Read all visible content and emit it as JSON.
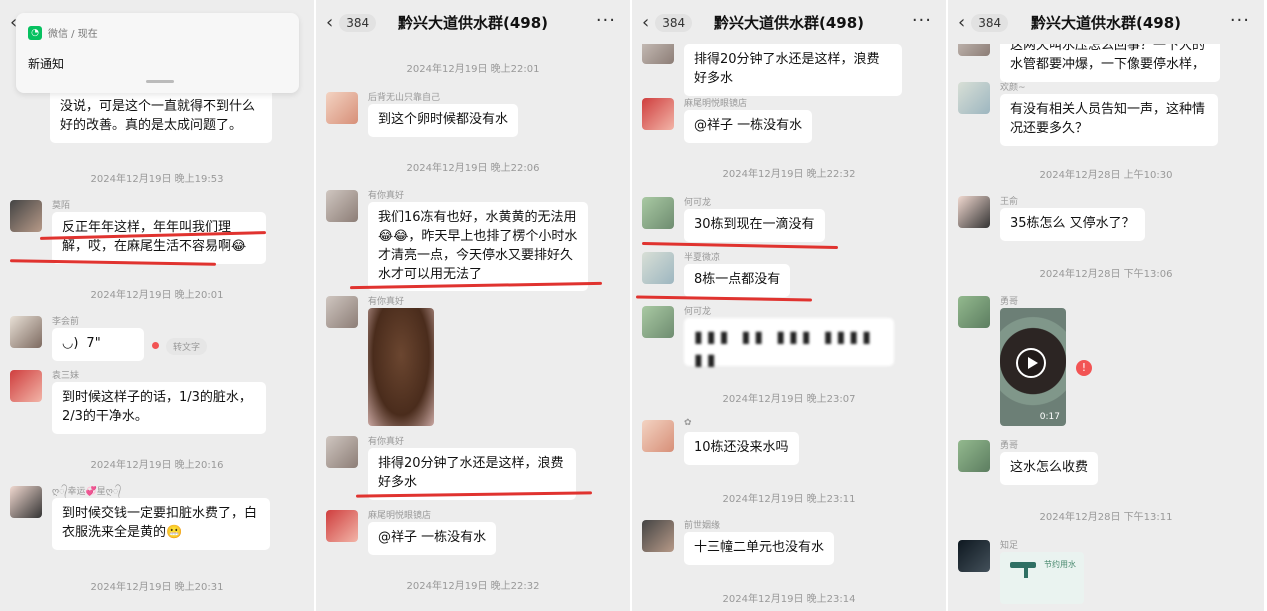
{
  "common": {
    "group_title": "黔兴大道供水群(498)",
    "unread_count": "384",
    "more_icon": "more-dots-icon"
  },
  "panel1": {
    "notification": {
      "app": "微信 / 现在",
      "text": "新通知"
    },
    "items": [
      {
        "type": "bubble_only",
        "text": "点，那我们想到大家都不容易，也没说，可是这个一直就得不到什么好的改善。真的是太成问题了。"
      },
      {
        "type": "time",
        "text": "2024年12月19日 晚上19:53"
      },
      {
        "type": "msg",
        "name": "莫陌",
        "text": "反正年年这样，年年叫我们理解，哎，在麻尾生活不容易啊😂"
      },
      {
        "type": "time",
        "text": "2024年12月19日 晚上20:01"
      },
      {
        "type": "voice",
        "name": "李会前",
        "text": "7\"",
        "convert": "转文字"
      },
      {
        "type": "msg",
        "name": "袁三妹",
        "text": "到时候这样子的话，1/3的脏水，2/3的干净水。"
      },
      {
        "type": "time",
        "text": "2024年12月19日 晚上20:16"
      },
      {
        "type": "msg",
        "name": "ღ᭄幸运💞星ღ᭄",
        "text": "到时候交钱一定要扣脏水费了，白衣服洗来全是黄的😬"
      },
      {
        "type": "time",
        "text": "2024年12月19日 晚上20:31"
      }
    ]
  },
  "panel2": {
    "items": [
      {
        "type": "time",
        "text": "2024年12月19日 晚上22:01"
      },
      {
        "type": "msg",
        "name": "后背无山只靠自己",
        "text": "到这个卵时候都没有水"
      },
      {
        "type": "time",
        "text": "2024年12月19日 晚上22:06"
      },
      {
        "type": "msg",
        "name": "有你真好",
        "text": "我们16冻有也好，水黄黄的无法用😂😂，昨天早上也排了楞个小时水才清亮一点，今天停水又要排好久水才可以用无法了"
      },
      {
        "type": "image",
        "name": "有你真好"
      },
      {
        "type": "msg",
        "name": "有你真好",
        "text": "排得20分钟了水还是这样，浪费好多水"
      },
      {
        "type": "msg",
        "name": "麻尾明悦眼镜店",
        "text": "@祥子  一栋没有水"
      },
      {
        "type": "time",
        "text": "2024年12月19日 晚上22:32"
      }
    ]
  },
  "panel3": {
    "items": [
      {
        "type": "bubble_only",
        "text": "排得20分钟了水还是这样，浪费好多水"
      },
      {
        "type": "msg",
        "name": "麻尾明悦眼镜店",
        "text": "@祥子  一栋没有水"
      },
      {
        "type": "time",
        "text": "2024年12月19日 晚上22:32"
      },
      {
        "type": "msg",
        "name": "何可龙",
        "text": "30栋到现在一滴没有"
      },
      {
        "type": "msg",
        "name": "半夏微凉",
        "text": "8栋一点都没有"
      },
      {
        "type": "msg",
        "name": "何可龙",
        "text": "▮▮▮ ▮▮ ▮▮▮ ▮▮▮▮ ▮▮"
      },
      {
        "type": "time",
        "text": "2024年12月19日 晚上23:07"
      },
      {
        "type": "msg",
        "name": "✿",
        "text": "10栋还没来水吗"
      },
      {
        "type": "time",
        "text": "2024年12月19日 晚上23:11"
      },
      {
        "type": "msg",
        "name": "前世姻缘",
        "text": "十三幢二单元也没有水"
      },
      {
        "type": "time",
        "text": "2024年12月19日 晚上23:14"
      }
    ]
  },
  "panel4": {
    "items": [
      {
        "type": "bubble_only",
        "text": "这两天叫水压怎么回事？一下大的水管都要冲爆，一下像要停水样，"
      },
      {
        "type": "msg",
        "name": "欢颜~",
        "text": "有没有相关人员告知一声，这种情况还要多久？"
      },
      {
        "type": "time",
        "text": "2024年12月28日 上午10:30"
      },
      {
        "type": "msg",
        "name": "王俞",
        "text": "35栋怎么 又停水了？"
      },
      {
        "type": "time",
        "text": "2024年12月28日 下午13:06"
      },
      {
        "type": "video",
        "name": "勇哥",
        "duration": "0:17"
      },
      {
        "type": "msg",
        "name": "勇哥",
        "text": "这水怎么收费"
      },
      {
        "type": "time",
        "text": "2024年12月28日 下午13:11"
      },
      {
        "type": "image_text",
        "name": "知足",
        "caption": "节约用水"
      }
    ]
  }
}
